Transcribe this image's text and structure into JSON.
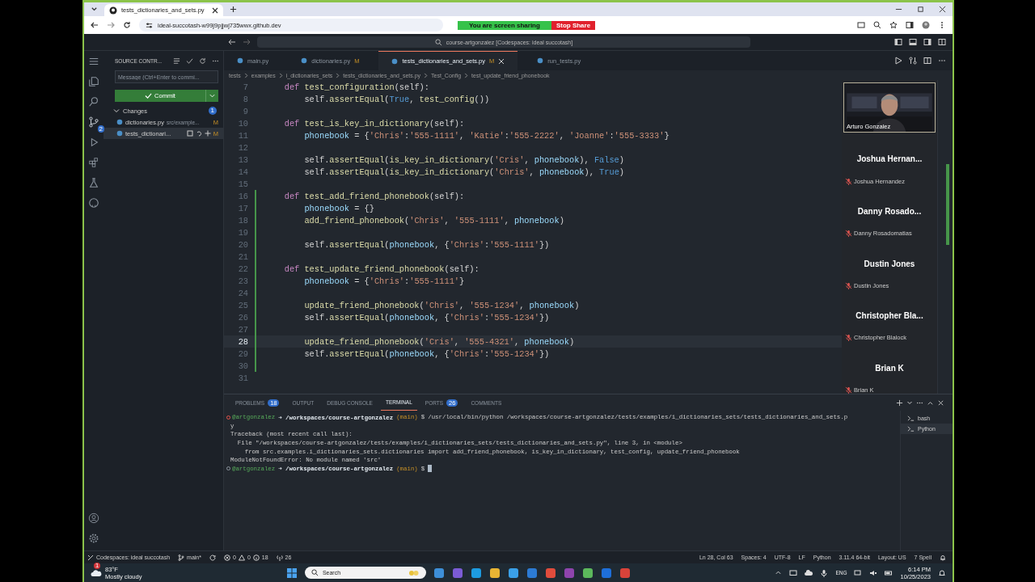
{
  "browser": {
    "tab_title": "tests_dictionaries_and_sets.py",
    "url": "ideal-succotash-w99j9pjjwj735wwx.github.dev",
    "sharing": {
      "message": "You are screen sharing",
      "stop": "Stop Share"
    }
  },
  "vscode": {
    "command_center": "course-artgonzalez [Codespaces: ideal succotash]",
    "activity_badge": "2",
    "sidebar": {
      "title": "SOURCE CONTR...",
      "message_placeholder": "Message (Ctrl+Enter to commi...",
      "commit": "Commit",
      "changes_label": "Changes",
      "changes_count": "1",
      "files": [
        {
          "name": "dictionaries.py",
          "path": "src/example...",
          "status": "M",
          "selected": false
        },
        {
          "name": "tests_dictionari...",
          "status": "M",
          "selected": true
        }
      ]
    },
    "tabs": [
      {
        "label": "main.py",
        "selected": false
      },
      {
        "label": "dictionaries.py",
        "status": "M",
        "selected": false
      },
      {
        "label": "tests_dictionaries_and_sets.py",
        "status": "M",
        "selected": true
      },
      {
        "label": "run_tests.py",
        "selected": false
      }
    ],
    "breadcrumbs": [
      "tests",
      "examples",
      "i_dictionaries_sets",
      "tests_dictionaries_and_sets.py",
      "Test_Config",
      "test_update_friend_phonebook"
    ],
    "code": [
      {
        "n": "7",
        "changed": false,
        "current": false,
        "tokens": [
          {
            "kind": "kw",
            "text": "    def "
          },
          {
            "kind": "fn",
            "text": "test_configuration"
          },
          {
            "kind": "p",
            "text": "(self):"
          }
        ]
      },
      {
        "n": "8",
        "changed": false,
        "current": false,
        "tokens": [
          {
            "kind": "p",
            "text": "        self."
          },
          {
            "kind": "fn",
            "text": "assertEqual"
          },
          {
            "kind": "p",
            "text": "("
          },
          {
            "kind": "c",
            "text": "True"
          },
          {
            "kind": "p",
            "text": ", "
          },
          {
            "kind": "fn",
            "text": "test_config"
          },
          {
            "kind": "p",
            "text": "())"
          }
        ]
      },
      {
        "n": "9",
        "changed": false,
        "current": false
      },
      {
        "n": "10",
        "changed": false,
        "current": false,
        "tokens": [
          {
            "kind": "kw",
            "text": "    def "
          },
          {
            "kind": "fn",
            "text": "test_is_key_in_dictionary"
          },
          {
            "kind": "p",
            "text": "(self):"
          }
        ]
      },
      {
        "n": "11",
        "changed": false,
        "current": false,
        "tokens": [
          {
            "kind": "v",
            "text": "        phonebook"
          },
          {
            "kind": "p",
            "text": " = {"
          },
          {
            "kind": "s",
            "text": "'Chris'"
          },
          {
            "kind": "p",
            "text": ":"
          },
          {
            "kind": "s",
            "text": "'555-1111'"
          },
          {
            "kind": "p",
            "text": ", "
          },
          {
            "kind": "s",
            "text": "'Katie'"
          },
          {
            "kind": "p",
            "text": ":"
          },
          {
            "kind": "s",
            "text": "'555-2222'"
          },
          {
            "kind": "p",
            "text": ", "
          },
          {
            "kind": "s",
            "text": "'Joanne'"
          },
          {
            "kind": "p",
            "text": ":"
          },
          {
            "kind": "s",
            "text": "'555-3333'"
          },
          {
            "kind": "p",
            "text": "}"
          }
        ]
      },
      {
        "n": "12",
        "changed": false,
        "current": false
      },
      {
        "n": "13",
        "changed": false,
        "current": false,
        "tokens": [
          {
            "kind": "p",
            "text": "        self."
          },
          {
            "kind": "fn",
            "text": "assertEqual"
          },
          {
            "kind": "p",
            "text": "("
          },
          {
            "kind": "fn",
            "text": "is_key_in_dictionary"
          },
          {
            "kind": "p",
            "text": "("
          },
          {
            "kind": "s",
            "text": "'Cris'"
          },
          {
            "kind": "p",
            "text": ", "
          },
          {
            "kind": "v",
            "text": "phonebook"
          },
          {
            "kind": "p",
            "text": "), "
          },
          {
            "kind": "c",
            "text": "False"
          },
          {
            "kind": "p",
            "text": ")"
          }
        ]
      },
      {
        "n": "14",
        "changed": false,
        "current": false,
        "tokens": [
          {
            "kind": "p",
            "text": "        self."
          },
          {
            "kind": "fn",
            "text": "assertEqual"
          },
          {
            "kind": "p",
            "text": "("
          },
          {
            "kind": "fn",
            "text": "is_key_in_dictionary"
          },
          {
            "kind": "p",
            "text": "("
          },
          {
            "kind": "s",
            "text": "'Chris'"
          },
          {
            "kind": "p",
            "text": ", "
          },
          {
            "kind": "v",
            "text": "phonebook"
          },
          {
            "kind": "p",
            "text": "), "
          },
          {
            "kind": "c",
            "text": "True"
          },
          {
            "kind": "p",
            "text": ")"
          }
        ]
      },
      {
        "n": "15",
        "changed": false,
        "current": false
      },
      {
        "n": "16",
        "changed": true,
        "current": false,
        "tokens": [
          {
            "kind": "kw",
            "text": "    def "
          },
          {
            "kind": "fn",
            "text": "test_add_friend_phonebook"
          },
          {
            "kind": "p",
            "text": "(self):"
          }
        ]
      },
      {
        "n": "17",
        "changed": true,
        "current": false,
        "tokens": [
          {
            "kind": "v",
            "text": "        phonebook"
          },
          {
            "kind": "p",
            "text": " = {}"
          }
        ]
      },
      {
        "n": "18",
        "changed": true,
        "current": false,
        "tokens": [
          {
            "kind": "fn",
            "text": "        add_friend_phonebook"
          },
          {
            "kind": "p",
            "text": "("
          },
          {
            "kind": "s",
            "text": "'Chris'"
          },
          {
            "kind": "p",
            "text": ", "
          },
          {
            "kind": "s",
            "text": "'555-1111'"
          },
          {
            "kind": "p",
            "text": ", "
          },
          {
            "kind": "v",
            "text": "phonebook"
          },
          {
            "kind": "p",
            "text": ")"
          }
        ]
      },
      {
        "n": "19",
        "changed": true,
        "current": false
      },
      {
        "n": "20",
        "changed": true,
        "current": false,
        "tokens": [
          {
            "kind": "p",
            "text": "        self."
          },
          {
            "kind": "fn",
            "text": "assertEqual"
          },
          {
            "kind": "p",
            "text": "("
          },
          {
            "kind": "v",
            "text": "phonebook"
          },
          {
            "kind": "p",
            "text": ", {"
          },
          {
            "kind": "s",
            "text": "'Chris'"
          },
          {
            "kind": "p",
            "text": ":"
          },
          {
            "kind": "s",
            "text": "'555-1111'"
          },
          {
            "kind": "p",
            "text": "})"
          }
        ]
      },
      {
        "n": "21",
        "changed": true,
        "current": false
      },
      {
        "n": "22",
        "changed": true,
        "current": false,
        "tokens": [
          {
            "kind": "kw",
            "text": "    def "
          },
          {
            "kind": "fn",
            "text": "test_update_friend_phonebook"
          },
          {
            "kind": "p",
            "text": "(self):"
          }
        ]
      },
      {
        "n": "23",
        "changed": true,
        "current": false,
        "tokens": [
          {
            "kind": "v",
            "text": "        phonebook"
          },
          {
            "kind": "p",
            "text": " = {"
          },
          {
            "kind": "s",
            "text": "'Chris'"
          },
          {
            "kind": "p",
            "text": ":"
          },
          {
            "kind": "s",
            "text": "'555-1111'"
          },
          {
            "kind": "p",
            "text": "}"
          }
        ]
      },
      {
        "n": "24",
        "changed": true,
        "current": false
      },
      {
        "n": "25",
        "changed": true,
        "current": false,
        "tokens": [
          {
            "kind": "fn",
            "text": "        update_friend_phonebook"
          },
          {
            "kind": "p",
            "text": "("
          },
          {
            "kind": "s",
            "text": "'Chris'"
          },
          {
            "kind": "p",
            "text": ", "
          },
          {
            "kind": "s",
            "text": "'555-1234'"
          },
          {
            "kind": "p",
            "text": ", "
          },
          {
            "kind": "v",
            "text": "phonebook"
          },
          {
            "kind": "p",
            "text": ")"
          }
        ]
      },
      {
        "n": "26",
        "changed": true,
        "current": false,
        "tokens": [
          {
            "kind": "p",
            "text": "        self."
          },
          {
            "kind": "fn",
            "text": "assertEqual"
          },
          {
            "kind": "p",
            "text": "("
          },
          {
            "kind": "v",
            "text": "phonebook"
          },
          {
            "kind": "p",
            "text": ", {"
          },
          {
            "kind": "s",
            "text": "'Chris'"
          },
          {
            "kind": "p",
            "text": ":"
          },
          {
            "kind": "s",
            "text": "'555-1234'"
          },
          {
            "kind": "p",
            "text": "})"
          }
        ]
      },
      {
        "n": "27",
        "changed": true,
        "current": false
      },
      {
        "n": "28",
        "changed": true,
        "current": true,
        "tokens": [
          {
            "kind": "fn",
            "text": "        update_friend_phonebook"
          },
          {
            "kind": "p",
            "text": "("
          },
          {
            "kind": "s",
            "text": "'Cris'"
          },
          {
            "kind": "p",
            "text": ", "
          },
          {
            "kind": "s",
            "text": "'555-4321'"
          },
          {
            "kind": "p",
            "text": ", "
          },
          {
            "kind": "v",
            "text": "phonebook"
          },
          {
            "kind": "p",
            "text": ")"
          }
        ]
      },
      {
        "n": "29",
        "changed": true,
        "current": false,
        "tokens": [
          {
            "kind": "p",
            "text": "        self."
          },
          {
            "kind": "fn",
            "text": "assertEqual"
          },
          {
            "kind": "p",
            "text": "("
          },
          {
            "kind": "v",
            "text": "phonebook"
          },
          {
            "kind": "p",
            "text": ", {"
          },
          {
            "kind": "s",
            "text": "'Chris'"
          },
          {
            "kind": "p",
            "text": ":"
          },
          {
            "kind": "s",
            "text": "'555-1234'"
          },
          {
            "kind": "p",
            "text": "})"
          }
        ]
      },
      {
        "n": "30",
        "changed": true,
        "current": false
      },
      {
        "n": "31",
        "changed": false,
        "current": false
      }
    ],
    "panel": {
      "tabs": [
        {
          "label": "PROBLEMS",
          "badge": "18",
          "selected": false
        },
        {
          "label": "OUTPUT",
          "selected": false
        },
        {
          "label": "DEBUG CONSOLE",
          "selected": false
        },
        {
          "label": "TERMINAL",
          "selected": true
        },
        {
          "label": "PORTS",
          "badge": "26",
          "selected": false
        },
        {
          "label": "COMMENTS",
          "selected": false
        }
      ],
      "terminal": [
        {
          "kind": "prompt",
          "failed": true,
          "user": "@artgonzalez",
          "arrow": "➜",
          "path": "/workspaces/course-artgonzalez",
          "branch": "(main)",
          "sign": "$",
          "command": "/usr/local/bin/python /workspaces/course-artgonzalez/tests/examples/i_dictionaries_sets/tests_dictionaries_and_sets.p",
          "cursor": false
        },
        {
          "kind": "output",
          "text": "y"
        },
        {
          "kind": "output",
          "text": "Traceback (most recent call last):"
        },
        {
          "kind": "output",
          "text": "  File \"/workspaces/course-artgonzalez/tests/examples/i_dictionaries_sets/tests_dictionaries_and_sets.py\", line 3, in <module>"
        },
        {
          "kind": "output",
          "text": "    from src.examples.i_dictionaries_sets.dictionaries import add_friend_phonebook, is_key_in_dictionary, test_config, update_friend_phonebook"
        },
        {
          "kind": "output",
          "text": "ModuleNotFoundError: No module named 'src'"
        },
        {
          "kind": "prompt",
          "failed": false,
          "user": "@artgonzalez",
          "arrow": "➜",
          "path": "/workspaces/course-artgonzalez",
          "branch": "(main)",
          "sign": "$",
          "cursor": true
        }
      ],
      "shells": [
        {
          "label": "bash",
          "selected": false
        },
        {
          "label": "Python",
          "selected": true
        }
      ]
    },
    "status": {
      "remote": "Codespaces: ideal succotash",
      "branch": "main*",
      "errors": "0",
      "warnings": "0",
      "infos": "18",
      "ports": "26",
      "right": [
        "Ln 28, Col 63",
        "Spaces: 4",
        "UTF-8",
        "LF",
        "Python",
        "3.11.4 64-bit",
        "Layout: US",
        "7 Spell"
      ]
    }
  },
  "meeting": {
    "host": {
      "name": "Arturo Gonzalez"
    },
    "participants": [
      {
        "display": "Joshua Hernan...",
        "name": "Joshua Hernandez",
        "muted": true
      },
      {
        "display": "Danny Rosado...",
        "name": "Danny Rosadomatias",
        "muted": true
      },
      {
        "display": "Dustin Jones",
        "name": "Dustin Jones",
        "muted": true
      },
      {
        "display": "Christopher Bla...",
        "name": "Christopher Blalock",
        "muted": true
      },
      {
        "display": "Brian K",
        "name": "Brian K",
        "muted": true
      }
    ]
  },
  "taskbar": {
    "temperature": "83°F",
    "weather": "Mostly cloudy",
    "weather_badge": "1",
    "search": "Search",
    "language": "ENG",
    "time": "6:14 PM",
    "date": "10/25/2023"
  }
}
